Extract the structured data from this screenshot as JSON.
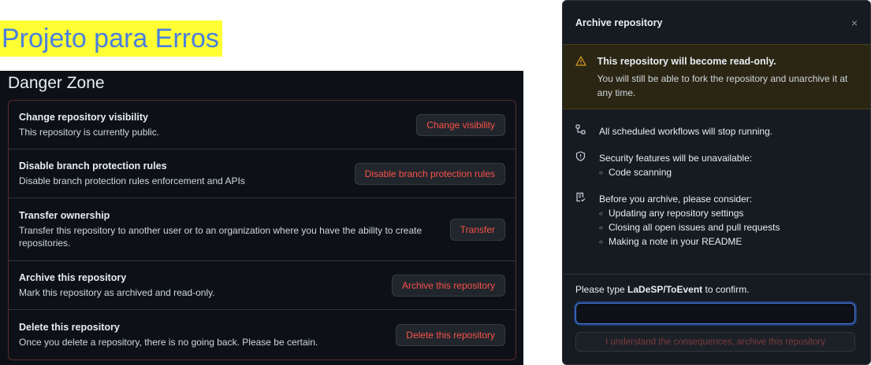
{
  "page_title": "Projeto para Erros",
  "danger_zone": {
    "heading": "Danger Zone",
    "rows": [
      {
        "title": "Change repository visibility",
        "description": "This repository is currently public.",
        "button": "Change visibility"
      },
      {
        "title": "Disable branch protection rules",
        "description": "Disable branch protection rules enforcement and APIs",
        "button": "Disable branch protection rules"
      },
      {
        "title": "Transfer ownership",
        "description": "Transfer this repository to another user or to an organization where you have the ability to create repositories.",
        "button": "Transfer"
      },
      {
        "title": "Archive this repository",
        "description": "Mark this repository as archived and read-only.",
        "button": "Archive this repository"
      },
      {
        "title": "Delete this repository",
        "description": "Once you delete a repository, there is no going back. Please be certain.",
        "button": "Delete this repository"
      }
    ]
  },
  "modal": {
    "title": "Archive repository",
    "close_glyph": "×",
    "warning": {
      "title": "This repository will become read-only.",
      "text": "You will still be able to fork the repository and unarchive it at any time."
    },
    "items": [
      {
        "icon": "workflow-icon",
        "text": "All scheduled workflows will stop running.",
        "bullets": []
      },
      {
        "icon": "shield-icon",
        "text": "Security features will be unavailable:",
        "bullets": [
          "Code scanning"
        ]
      },
      {
        "icon": "checklist-icon",
        "text": "Before you archive, please consider:",
        "bullets": [
          "Updating any repository settings",
          "Closing all open issues and pull requests",
          "Making a note in your README"
        ]
      }
    ],
    "confirm_prefix": "Please type ",
    "confirm_repo": "LaDeSP/ToEvent",
    "confirm_suffix": " to confirm.",
    "input_value": "",
    "confirm_button": "I understand the consequences, archive this repository"
  },
  "colors": {
    "danger": "#f85149",
    "warning": "#d29922",
    "highlight": "#ffff33",
    "title_text": "#4a7fe0"
  }
}
